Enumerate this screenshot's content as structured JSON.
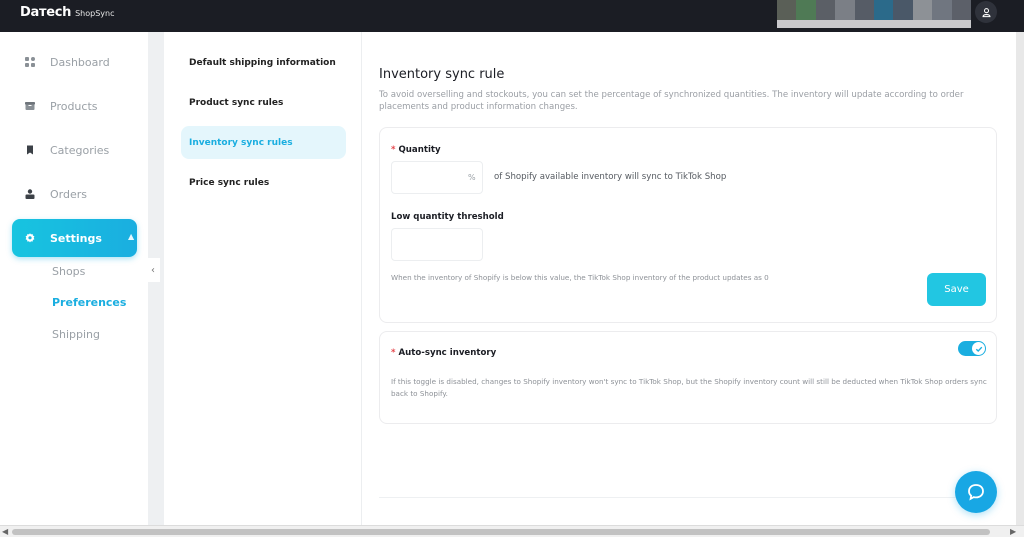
{
  "app": {
    "brand_main": "Daтech",
    "brand_sub": "ShopSync",
    "user_icon": "user-icon"
  },
  "sidebar": {
    "items": [
      {
        "label": "Dashboard",
        "icon": "dashboard-grid-icon"
      },
      {
        "label": "Products",
        "icon": "box-icon"
      },
      {
        "label": "Categories",
        "icon": "bookmark-icon"
      },
      {
        "label": "Orders",
        "icon": "orders-icon"
      },
      {
        "label": "Settings",
        "icon": "gear-icon",
        "active": true
      }
    ],
    "settings_sub": [
      {
        "label": "Shops"
      },
      {
        "label": "Preferences",
        "active": true
      },
      {
        "label": "Shipping"
      }
    ]
  },
  "settings_menu": {
    "items": [
      {
        "label": "Default shipping information"
      },
      {
        "label": "Product sync rules"
      },
      {
        "label": "Inventory sync rules",
        "active": true
      },
      {
        "label": "Price sync rules"
      }
    ]
  },
  "content": {
    "title": "Inventory sync rule",
    "description": "To avoid overselling and stockouts, you can set the percentage of synchronized quantities. The inventory will update according to order placements and product information changes.",
    "quantity": {
      "required_mark": "*",
      "label": "Quantity",
      "value": "",
      "unit": "%",
      "suffix_text": "of Shopify available inventory will sync to TikTok Shop"
    },
    "low_threshold": {
      "label": "Low quantity threshold",
      "value": "",
      "help": "When the inventory of Shopify is below this value, the TikTok Shop inventory of the product updates as 0"
    },
    "save_label": "Save",
    "auto_sync": {
      "required_mark": "*",
      "label": "Auto-sync inventory",
      "enabled": true,
      "help": "If this toggle is disabled, changes to Shopify inventory won't sync to TikTok Shop, but the Shopify inventory count will still be deducted when TikTok Shop orders sync back to Shopify."
    }
  },
  "colors": {
    "accent": "#1aaee0",
    "topbar": "#1b1d24",
    "required": "#e5484d"
  }
}
